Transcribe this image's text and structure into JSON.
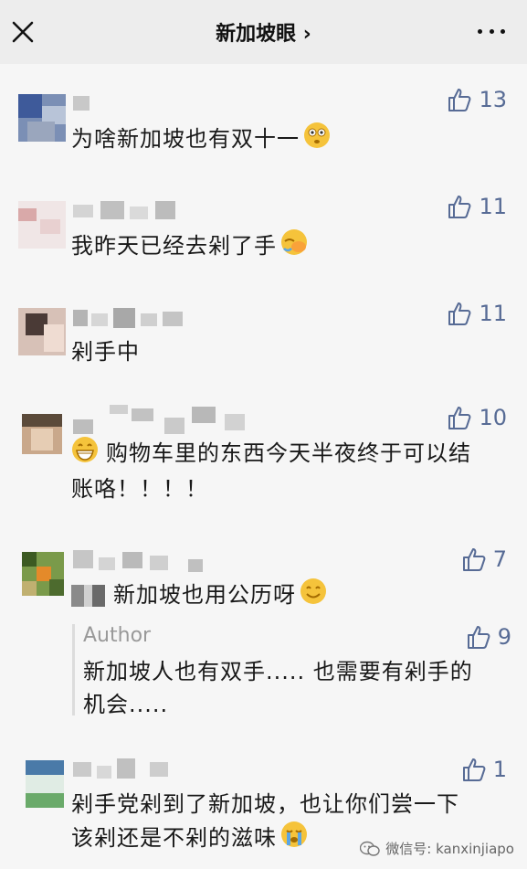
{
  "header": {
    "title": "新加坡眼 ›"
  },
  "comments": [
    {
      "likes": "13",
      "text": "为啥新加坡也有双十一"
    },
    {
      "likes": "11",
      "text": "我昨天已经去剁了手"
    },
    {
      "likes": "11",
      "text": "剁手中"
    },
    {
      "likes": "10",
      "text_line1": "购物车里的东西今天半夜终于可以结",
      "text_line2": "账咯！！！！"
    },
    {
      "likes": "7",
      "text": "新加坡也用公历呀"
    },
    {
      "likes": "1",
      "text_line1": "剁手党剁到了新加坡，也让你们尝一下",
      "text_line2": "该剁还是不剁的滋味"
    }
  ],
  "author_reply": {
    "label": "Author",
    "likes": "9",
    "text_line1": "新加坡人也有双手..... 也需要有剁手的",
    "text_line2": "机会....."
  },
  "watermark": {
    "text": "微信号: kanxinjiapo"
  },
  "colors": {
    "link": "#576b95",
    "bg": "#f6f6f6",
    "header_bg": "#ededed"
  }
}
